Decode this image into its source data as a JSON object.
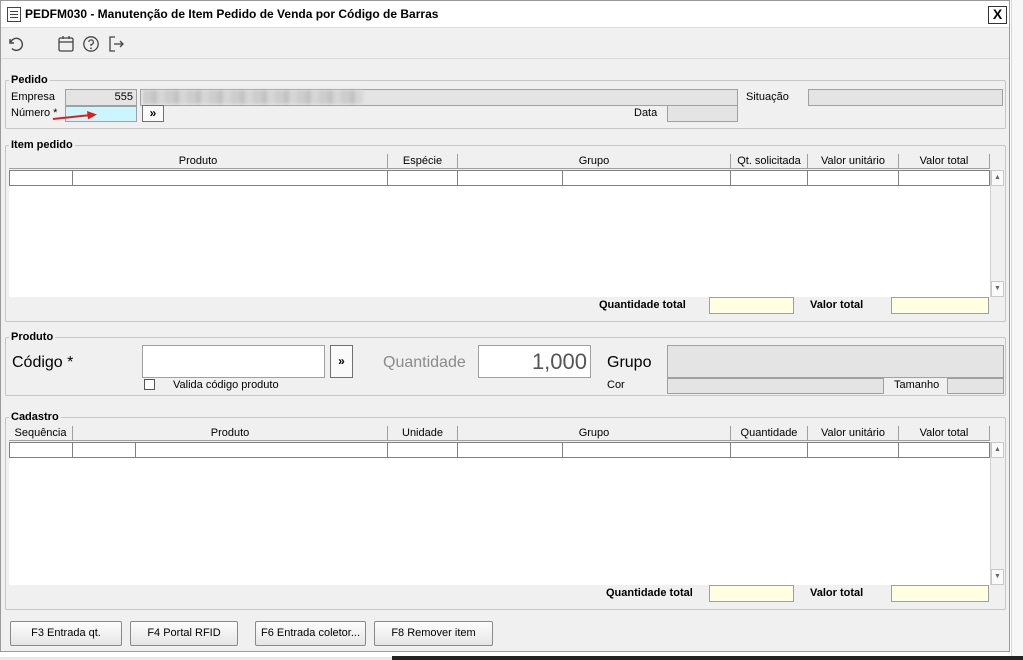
{
  "window": {
    "title": "PEDFM030 - Manutenção de Item Pedido de Venda por Código de Barras",
    "close_label": "X"
  },
  "toolbar": {
    "icons": [
      "undo-icon",
      "calendar-icon",
      "help-icon",
      "exit-icon"
    ]
  },
  "pedido": {
    "legend": "Pedido",
    "empresa_label": "Empresa",
    "empresa_value": "555",
    "numero_label": "Número *",
    "numero_value": "",
    "lookup_label": "»",
    "situacao_label": "Situação",
    "data_label": "Data"
  },
  "item_pedido": {
    "legend": "Item pedido",
    "columns": [
      "Produto",
      "Espécie",
      "Grupo",
      "Qt. solicitada",
      "Valor unitário",
      "Valor total"
    ],
    "qtd_total_label": "Quantidade total",
    "valor_total_label": "Valor total"
  },
  "produto": {
    "legend": "Produto",
    "codigo_label": "Código *",
    "codigo_value": "",
    "lookup_label": "»",
    "quantidade_label": "Quantidade",
    "quantidade_value": "1,000",
    "grupo_label": "Grupo",
    "valida_label": "Valida código produto",
    "cor_label": "Cor",
    "tamanho_label": "Tamanho"
  },
  "cadastro": {
    "legend": "Cadastro",
    "columns": [
      "Sequência",
      "Produto",
      "Unidade",
      "Grupo",
      "Quantidade",
      "Valor unitário",
      "Valor total"
    ],
    "qtd_total_label": "Quantidade total",
    "valor_total_label": "Valor total"
  },
  "footer": {
    "f3": "F3 Entrada qt.",
    "f4": "F4 Portal RFID",
    "f6": "F6 Entrada coletor...",
    "f8": "F8 Remover item"
  },
  "colors": {
    "numero_field_bg": "#ccf6ff",
    "total_field_bg": "#ffffe1",
    "annotation_arrow": "#e51c1c"
  }
}
